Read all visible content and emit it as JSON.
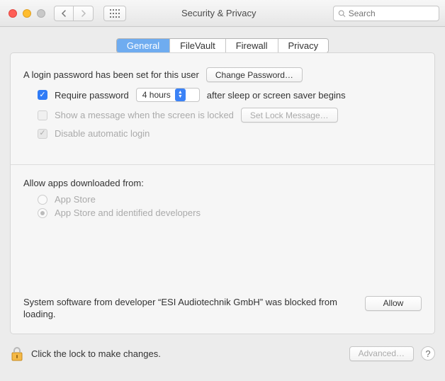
{
  "window_title": "Security & Privacy",
  "search": {
    "placeholder": "Search"
  },
  "tabs": {
    "general": "General",
    "filevault": "FileVault",
    "firewall": "Firewall",
    "privacy": "Privacy"
  },
  "login": {
    "text": "A login password has been set for this user",
    "change_btn": "Change Password…",
    "require_label": "Require password",
    "after_label": "after sleep or screen saver begins",
    "delay_value": "4 hours",
    "show_msg_label": "Show a message when the screen is locked",
    "set_lock_btn": "Set Lock Message…",
    "disable_auto_label": "Disable automatic login"
  },
  "downloads": {
    "heading": "Allow apps downloaded from:",
    "opt1": "App Store",
    "opt2": "App Store and identified developers"
  },
  "blocked": {
    "text": "System software from developer “ESI Audiotechnik GmbH” was blocked from loading.",
    "allow_btn": "Allow"
  },
  "footer": {
    "lock_text": "Click the lock to make changes.",
    "advanced_btn": "Advanced…"
  }
}
